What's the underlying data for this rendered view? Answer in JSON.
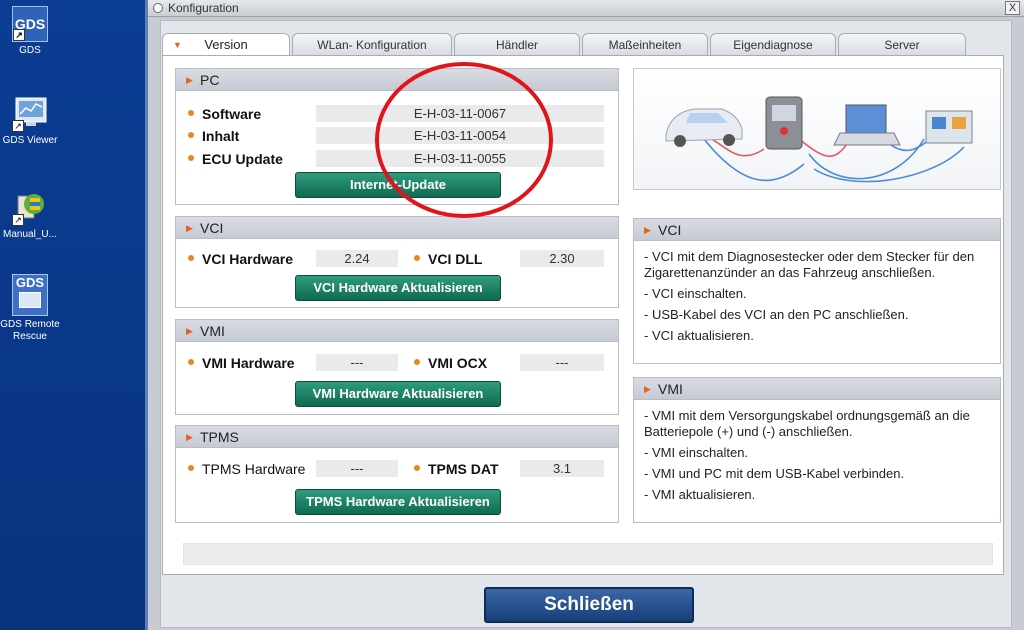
{
  "desktop": {
    "icons": [
      {
        "label": "GDS",
        "img_text": "GDS"
      },
      {
        "label": "GDS Viewer"
      },
      {
        "label": "Manual_U..."
      },
      {
        "label": "GDS Remote Rescue",
        "img_text": "GDS"
      }
    ]
  },
  "window": {
    "title": "Konfiguration",
    "close": "X"
  },
  "tabs": [
    "Version",
    "WLan- Konfiguration",
    "Händler",
    "Maßeinheiten",
    "Eigendiagnose",
    "Server"
  ],
  "pc": {
    "title": "PC",
    "rows": [
      {
        "label": "Software",
        "value": "E-H-03-11-0067"
      },
      {
        "label": "Inhalt",
        "value": "E-H-03-11-0054"
      },
      {
        "label": "ECU Update",
        "value": "E-H-03-11-0055"
      }
    ],
    "button": "Internet-Update"
  },
  "vci": {
    "title": "VCI",
    "hw_label": "VCI Hardware",
    "hw_value": "2.24",
    "dll_label": "VCI DLL",
    "dll_value": "2.30",
    "button": "VCI Hardware Aktualisieren"
  },
  "vmi": {
    "title": "VMI",
    "hw_label": "VMI Hardware",
    "hw_value": "---",
    "ocx_label": "VMI OCX",
    "ocx_value": "---",
    "button": "VMI Hardware Aktualisieren"
  },
  "tpms": {
    "title": "TPMS",
    "hw_label": "TPMS Hardware",
    "hw_value": "---",
    "dat_label": "TPMS DAT",
    "dat_value": "3.1",
    "button": "TPMS Hardware Aktualisieren"
  },
  "vci_info": {
    "title": "VCI",
    "lines": [
      "- VCI mit dem Diagnosestecker oder dem Stecker für den Zigarettenanzünder an das Fahrzeug anschließen.",
      "- VCI einschalten.",
      "- USB-Kabel des VCI an den PC anschließen.",
      "- VCI aktualisieren."
    ]
  },
  "vmi_info": {
    "title": "VMI",
    "lines": [
      "- VMI mit dem Versorgungskabel ordnungsgemäß an die Batteriepole (+) und (-) anschließen.",
      "- VMI einschalten.",
      "- VMI und PC mit dem USB-Kabel verbinden.",
      "- VMI aktualisieren."
    ]
  },
  "footer": {
    "close_button": "Schließen"
  },
  "colors": {
    "accent_orange": "#e7891f",
    "button_green": "#0f6a52",
    "annotation_red": "#e0141b",
    "close_blue": "#173f7a"
  }
}
